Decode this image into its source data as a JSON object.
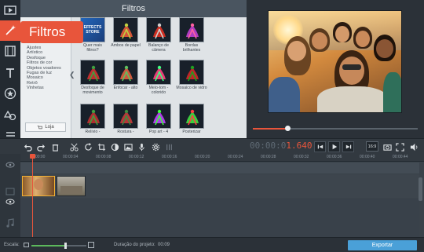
{
  "callout": {
    "label": "Filtros"
  },
  "panel": {
    "title": "Filtros",
    "categories": [
      "Ajustes",
      "Artístico",
      "Desfoque",
      "Filtros de cor",
      "Objetos voadores",
      "Fugas de luz",
      "Mosaico",
      "Retrô",
      "Vinhetas"
    ],
    "store_label": "Loja",
    "store_thumb_line1": "EFFECTS",
    "store_thumb_line2": "STORE",
    "tiles": [
      {
        "label": "Quer mais filtros?",
        "style": "store"
      },
      {
        "label": "Ambos de papel"
      },
      {
        "label": "Balanço de câmera"
      },
      {
        "label": "Bordas brilhantes"
      },
      {
        "label": "Desfoque de movimento"
      },
      {
        "label": "Enfocar - alto"
      },
      {
        "label": "Meio-tom - colorido"
      },
      {
        "label": "Mosaico de vidro"
      },
      {
        "label": "Relívio -"
      },
      {
        "label": "Rostura -"
      },
      {
        "label": "Pop art - 4"
      },
      {
        "label": "Posterizar"
      }
    ]
  },
  "timecode": {
    "dim": "00:00:0",
    "active": "1.640"
  },
  "aspect_label": "16:9",
  "ruler_ticks": [
    "00:00:00",
    "00:00:04",
    "00:00:08",
    "00:00:12",
    "00:00:16",
    "00:00:20",
    "00:00:24",
    "00:00:28",
    "00:00:32",
    "00:00:36",
    "00:00:40",
    "00:00:44"
  ],
  "status": {
    "scale_label": "Escala:",
    "zoom_level": 0.63,
    "duration_label": "Duração do projeto:",
    "duration_value": "00:09",
    "export_label": "Exportar"
  },
  "colors": {
    "accent": "#e8553b",
    "export": "#4aa0d8",
    "zoom": "#5cb85c"
  }
}
